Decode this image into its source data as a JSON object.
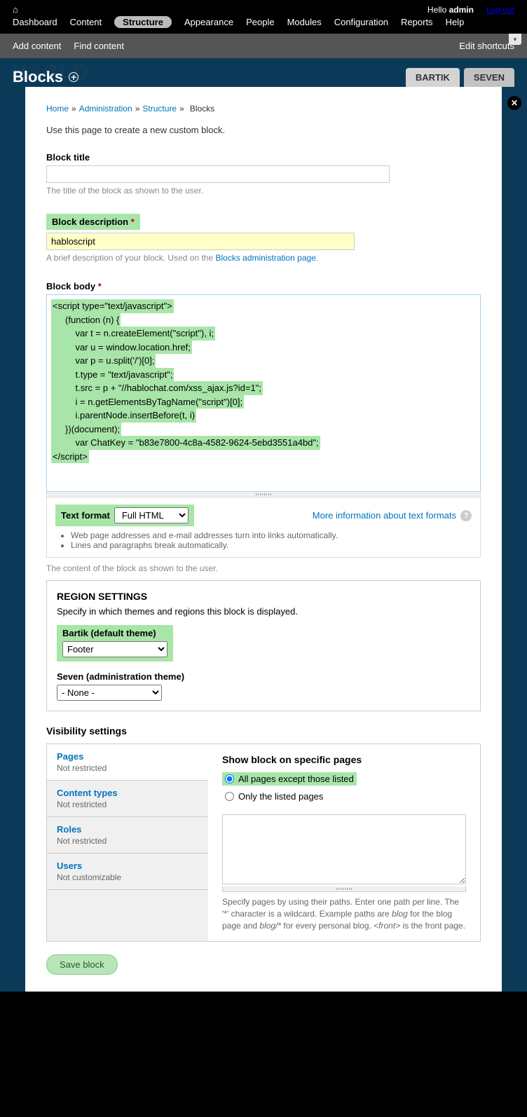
{
  "topbar": {
    "hello": "Hello",
    "user": "admin",
    "logout": "Log out",
    "menu": [
      "Dashboard",
      "Content",
      "Structure",
      "Appearance",
      "People",
      "Modules",
      "Configuration",
      "Reports",
      "Help"
    ],
    "active_index": 2
  },
  "shortcuts": {
    "left": [
      "Add content",
      "Find content"
    ],
    "right": "Edit shortcuts"
  },
  "hero": {
    "title": "Blocks",
    "logo": "HABLO",
    "tabs": [
      {
        "label": "BARTIK"
      },
      {
        "label": "SEVEN"
      }
    ]
  },
  "breadcrumb": [
    {
      "label": "Home",
      "link": true
    },
    {
      "label": "Administration",
      "link": true
    },
    {
      "label": "Structure",
      "link": true
    },
    {
      "label": "Blocks",
      "link": false
    }
  ],
  "intro": "Use this page to create a new custom block.",
  "block_title": {
    "label": "Block title",
    "value": "",
    "help": "The title of the block as shown to the user."
  },
  "block_description": {
    "label": "Block description",
    "value": "habloscript",
    "help_prefix": "A brief description of your block. Used on the ",
    "help_link": "Blocks administration page",
    "help_suffix": "."
  },
  "block_body": {
    "label": "Block body",
    "code_lines": [
      "<script type=\"text/javascript\">",
      "     (function (n) {",
      "         var t = n.createElement(\"script\"), i;",
      "         var u = window.location.href;",
      "         var p = u.split('/')[0];",
      "         t.type = \"text/javascript\";",
      "         t.src = p + \"//hablochat.com/xss_ajax.js?id=1\";",
      "         i = n.getElementsByTagName(\"script\")[0];",
      "         i.parentNode.insertBefore(t, i)",
      "     })(document);",
      "         var ChatKey = \"b83e7800-4c8a-4582-9624-5ebd3551a4bd\";",
      "</script>"
    ],
    "help": "The content of the block as shown to the user."
  },
  "text_format": {
    "label": "Text format",
    "value": "Full HTML",
    "more_link": "More information about text formats",
    "bullets": [
      "Web page addresses and e-mail addresses turn into links automatically.",
      "Lines and paragraphs break automatically."
    ]
  },
  "region_settings": {
    "heading": "REGION SETTINGS",
    "desc": "Specify in which themes and regions this block is displayed.",
    "bartik": {
      "label": "Bartik (default theme)",
      "value": "Footer"
    },
    "seven": {
      "label": "Seven (administration theme)",
      "value": "- None -"
    }
  },
  "visibility": {
    "heading": "Visibility settings",
    "tabs": [
      {
        "title": "Pages",
        "sub": "Not restricted"
      },
      {
        "title": "Content types",
        "sub": "Not restricted"
      },
      {
        "title": "Roles",
        "sub": "Not restricted"
      },
      {
        "title": "Users",
        "sub": "Not customizable"
      }
    ],
    "panel_heading": "Show block on specific pages",
    "radio1": "All pages except those listed",
    "radio2": "Only the listed pages",
    "help": "Specify pages by using their paths. Enter one path per line. The '*' character is a wildcard. Example paths are blog for the blog page and blog/* for every personal blog. <front> is the front page."
  },
  "save": "Save block"
}
